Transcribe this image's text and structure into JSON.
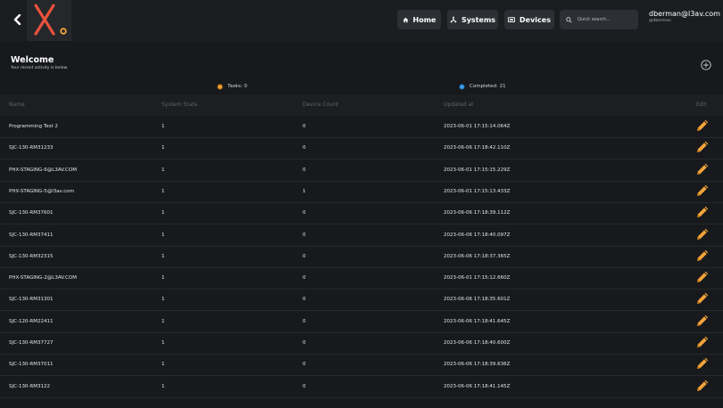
{
  "nav": {
    "home_label": "Home",
    "systems_label": "Systems",
    "devices_label": "Devices",
    "search_placeholder": "Quick search..."
  },
  "user": {
    "email": "dberman@l3av.com",
    "handle": "@dberman"
  },
  "welcome": {
    "title": "Welcome",
    "subtitle": "Your recent activity is below."
  },
  "stats": {
    "tasks": "Tasks: 0",
    "tasks_color": "#f0a030",
    "completed": "Completed: 21",
    "completed_color": "#3a9ee8"
  },
  "colors": {
    "accent": "#f2a33a",
    "background": "#17191c",
    "logo_x": "#e8523a"
  },
  "table": {
    "headers": {
      "name": "Name",
      "state": "System State",
      "count": "Device Count",
      "updated": "Updated at",
      "edit": "Edit"
    },
    "rows": [
      {
        "name": "Programming Test 2",
        "state": "1",
        "count": "0",
        "updated": "2023-06-01 17:15:14.064Z"
      },
      {
        "name": "SJC-130-RM31233",
        "state": "1",
        "count": "0",
        "updated": "2023-06-06 17:18:42.110Z"
      },
      {
        "name": "PHX-STAGING-6@L3AV.COM",
        "state": "1",
        "count": "0",
        "updated": "2023-06-01 17:15:15.229Z"
      },
      {
        "name": "PHX-STAGING-5@l3av.com",
        "state": "1",
        "count": "1",
        "updated": "2023-06-01 17:15:13.433Z"
      },
      {
        "name": "SJC-130-RM37601",
        "state": "1",
        "count": "0",
        "updated": "2023-06-06 17:18:39.112Z"
      },
      {
        "name": "SJC-130-RM37411",
        "state": "1",
        "count": "0",
        "updated": "2023-06-06 17:18:40.097Z"
      },
      {
        "name": "SJC-130-RM32315",
        "state": "1",
        "count": "0",
        "updated": "2023-06-06 17:18:37.365Z"
      },
      {
        "name": "PHX-STAGING-2@L3AV.COM",
        "state": "1",
        "count": "0",
        "updated": "2023-06-01 17:15:12.660Z"
      },
      {
        "name": "SJC-130-RM31301",
        "state": "1",
        "count": "0",
        "updated": "2023-06-06 17:18:35.601Z"
      },
      {
        "name": "SJC-120-RM22411",
        "state": "1",
        "count": "0",
        "updated": "2023-06-06 17:18:41.645Z"
      },
      {
        "name": "SJC-130-RM37727",
        "state": "1",
        "count": "0",
        "updated": "2023-06-06 17:18:40.600Z"
      },
      {
        "name": "SJC-130-RM37011",
        "state": "1",
        "count": "0",
        "updated": "2023-06-06 17:18:39.636Z"
      },
      {
        "name": "SJC-130-RM3122",
        "state": "1",
        "count": "0",
        "updated": "2023-06-06 17:18:41.145Z"
      }
    ]
  }
}
